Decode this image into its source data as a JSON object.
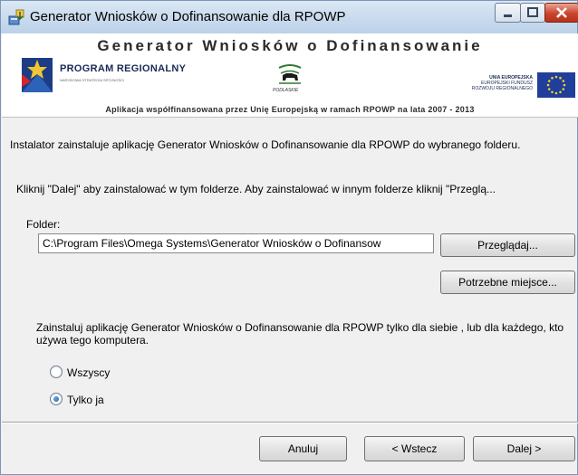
{
  "window": {
    "title": "Generator Wniosków o Dofinansowanie dla RPOWP"
  },
  "banner": {
    "title": "Generator Wniosków o Dofinansowanie",
    "program_name": "PROGRAM REGIONALNY",
    "program_sub": "NARODOWA STRATEGIA SPÓJNOŚCI",
    "podlaskie_label": "PODLASKIE",
    "eu_line1": "UNIA EUROPEJSKA",
    "eu_line2": "EUROPEJSKI FUNDUSZ",
    "eu_line3": "ROZWOJU REGIONALNEGO",
    "footer": "Aplikacja współfinansowana przez Unię Europejską w ramach RPOWP na lata 2007 - 2013"
  },
  "content": {
    "intro": "Instalator zainstaluje aplikację Generator Wniosków o Dofinansowanie dla RPOWP do wybranego folderu.",
    "hint": "Kliknij \"Dalej\" aby zainstalować w tym folderze. Aby zainstalować w innym folderze kliknij \"Przeglą...",
    "folder_label": "Folder:",
    "folder_value": "C:\\Program Files\\Omega Systems\\Generator Wniosków o Dofinansow",
    "browse_button": "Przeglądaj...",
    "space_button": "Potrzebne miejsce...",
    "scope_text": "Zainstaluj aplikację Generator Wniosków o Dofinansowanie dla RPOWP tylko dla siebie , lub dla każdego, kto używa tego komputera.",
    "radio_all": "Wszyscy",
    "radio_me": "Tylko ja",
    "selected_option": "Tylko ja"
  },
  "footer": {
    "cancel": "Anuluj",
    "back": "< Wstecz",
    "next": "Dalej >"
  },
  "icons": {
    "app": "installer-icon",
    "minimize": "minimize-icon",
    "maximize": "maximize-icon",
    "close": "close-icon"
  },
  "colors": {
    "close_button": "#c9452c",
    "radio_selected": "#1f5fa3",
    "titlebar": "#c7d9ec"
  }
}
